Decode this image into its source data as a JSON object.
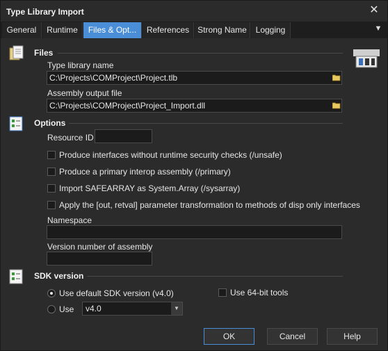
{
  "window": {
    "title": "Type Library Import",
    "close_glyph": "✕"
  },
  "tabs": [
    {
      "label": "General"
    },
    {
      "label": "Runtime"
    },
    {
      "label": "Files & Opt..."
    },
    {
      "label": "References"
    },
    {
      "label": "Strong Name"
    },
    {
      "label": "Logging"
    }
  ],
  "active_tab_index": 2,
  "tab_menu_glyph": "▼",
  "files": {
    "title": "Files",
    "icon": "files-icon",
    "type_library_label": "Type library name",
    "type_library_value": "C:\\Projects\\COMProject\\Project.tlb",
    "assembly_output_label": "Assembly output file",
    "assembly_output_value": "C:\\Projects\\COMProject\\Project_Import.dll",
    "logo_icon": "action-logo-icon"
  },
  "options": {
    "title": "Options",
    "icon": "options-checklist-icon",
    "resource_id_label": "Resource ID",
    "resource_id_value": "",
    "checkboxes": [
      {
        "label": "Produce interfaces without runtime security checks (/unsafe)",
        "checked": false
      },
      {
        "label": "Produce a primary interop assembly (/primary)",
        "checked": false
      },
      {
        "label": "Import SAFEARRAY as System.Array (/sysarray)",
        "checked": false
      },
      {
        "label": "Apply the [out, retval] parameter transformation to methods of disp only interfaces",
        "checked": false
      }
    ],
    "namespace_label": "Namespace",
    "namespace_value": "",
    "version_label": "Version number of assembly",
    "version_value": ""
  },
  "sdk": {
    "title": "SDK version",
    "icon": "sdk-checklist-icon",
    "default_radio_label": "Use default SDK version (v4.0)",
    "use_radio_label": "Use",
    "selected_radio": "default",
    "use_64bit_label": "Use 64-bit tools",
    "use_64bit_checked": false,
    "version_select_value": "v4.0"
  },
  "buttons": {
    "ok": "OK",
    "cancel": "Cancel",
    "help": "Help"
  },
  "colors": {
    "accent": "#4a8ed8",
    "background": "#2b2b2b",
    "field_background": "#1b1b1b"
  }
}
